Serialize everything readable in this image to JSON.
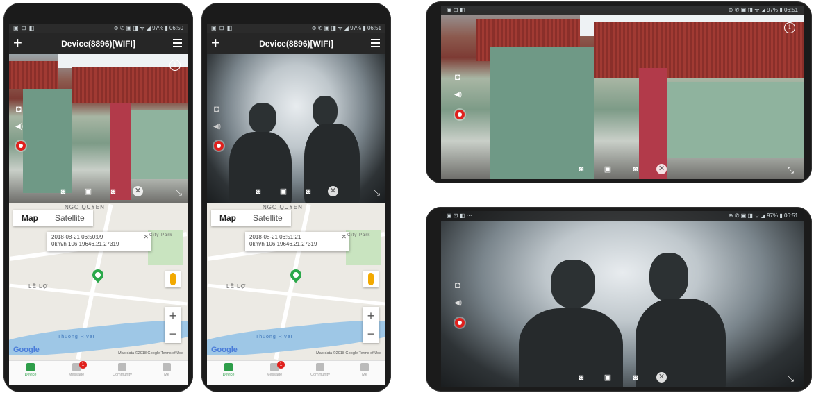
{
  "portrait_screens": [
    {
      "status_time": "06:50",
      "status_left": "▣ ⊡ ◧ ···",
      "status_right": "⊕ ✆ ▣ ◨ ᯤ ◢ 97% ▮ 06:50",
      "title": "Device(8896)[WIFI]",
      "info_window": {
        "line1": "2018-08-21 06:50:09",
        "line2": "0km/h 106.19646,21.27319"
      }
    },
    {
      "status_time": "06:51",
      "status_left": "▣ ⊡ ◧ ···",
      "status_right": "⊕ ✆ ▣ ◨ ᯤ ◢ 97% ▮ 06:51",
      "title": "Device(8896)[WIFI]",
      "info_window": {
        "line1": "2018-08-21 06:51:21",
        "line2": "0km/h 106.19646,21.27319"
      }
    }
  ],
  "map": {
    "tab_map": "Map",
    "tab_satellite": "Satellite",
    "label_street": "NGO QUYEN",
    "label_district": "LÊ LỢI",
    "label_river": "Thuong River",
    "label_park": "City Park",
    "google": "Google",
    "attribution": "Map data ©2018 Google   Terms of Use",
    "zoom_in": "+",
    "zoom_out": "−"
  },
  "bottom_nav": {
    "device": "Device",
    "message": "Message",
    "message_badge": "1",
    "community": "Community",
    "me": "Me"
  },
  "landscape_screens": [
    {
      "status_right": "⊕ ✆ ▣ ◨ ᯤ ◢ 97% ▮ 06:51",
      "status_left": "▣ ⊡ ◧ ···"
    },
    {
      "status_right": "⊕ ✆ ▣ ◨ ᯤ ◢ 97% ▮ 06:51",
      "status_left": "▣ ⊡ ◧ ···"
    }
  ],
  "video_overlay": {
    "info_glyph": "i",
    "camera_glyph": "◘",
    "volume_glyph": "◀)",
    "close_glyph": "✕",
    "expand_glyph": "⤡",
    "record_glyph": "●",
    "snapshot_glyph": "📷",
    "video_glyph": "▣",
    "photo_glyph": "◙"
  },
  "colors": {
    "record": "#e0201d",
    "nav_active": "#2e9e4a",
    "appbar": "#262626",
    "map_pin": "#2aa84a"
  }
}
